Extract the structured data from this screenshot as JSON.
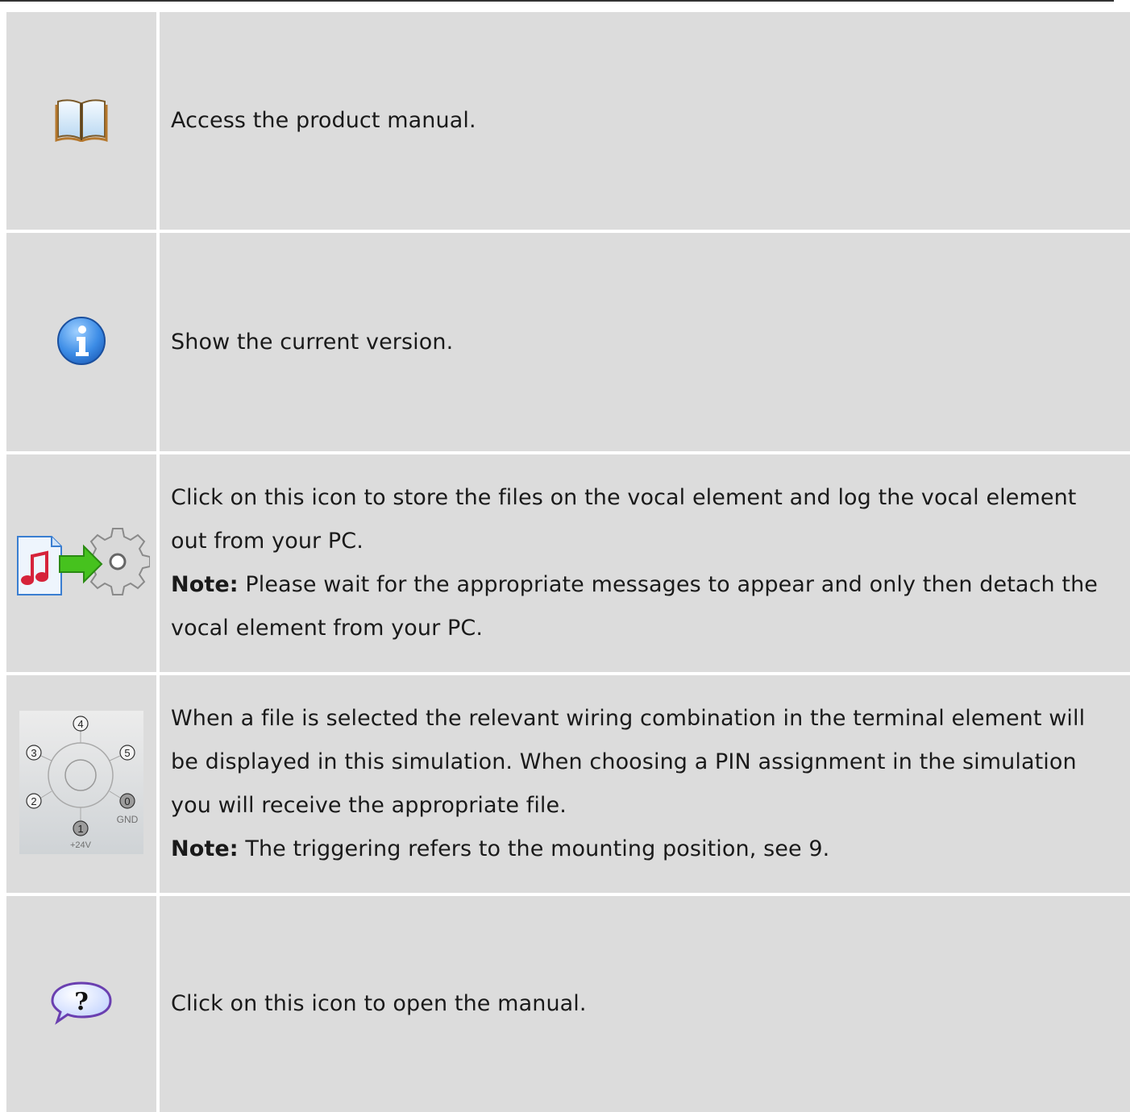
{
  "rows": [
    {
      "icon": "book-icon",
      "text": "Access the product manual."
    },
    {
      "icon": "info-icon",
      "text": "Show the current version."
    },
    {
      "icon": "music-file-to-gear-icon",
      "text": "Click on this icon to store the files on the vocal element and log the vocal element out from your PC.",
      "note_label": "Note:",
      "note_text": " Please wait for the appropriate messages to appear and only then detach the vocal element from your PC."
    },
    {
      "icon": "wiring-pin-simulation-icon",
      "pins": [
        "4",
        "3",
        "5",
        "2",
        "0",
        "1"
      ],
      "pin_labels": {
        "gnd": "GND",
        "v24": "+24V"
      },
      "text": "When a file is selected the relevant wiring combination in the terminal element will be displayed in this simulation. When choosing a PIN assignment in the simulation you will receive the appropriate file.",
      "note_label": "Note:",
      "note_text": " The triggering refers to the mounting position, see 9."
    },
    {
      "icon": "help-bubble-icon",
      "help_glyph": "?",
      "text": "Click on this icon to open the manual."
    }
  ]
}
